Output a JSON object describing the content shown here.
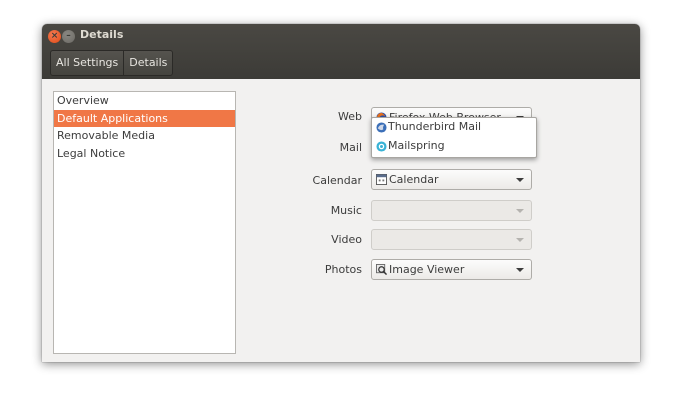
{
  "window": {
    "title": "Details"
  },
  "titlebar": {
    "close_icon": "close-icon",
    "minimize_icon": "minimize-icon"
  },
  "breadcrumbs": [
    "All Settings",
    "Details"
  ],
  "sidebar": {
    "items": [
      {
        "label": "Overview",
        "selected": false
      },
      {
        "label": "Default Applications",
        "selected": true
      },
      {
        "label": "Removable Media",
        "selected": false
      },
      {
        "label": "Legal Notice",
        "selected": false
      }
    ]
  },
  "defaults": {
    "web": {
      "label": "Web",
      "value": "Firefox Web Browser",
      "icon": "firefox-icon",
      "enabled": true
    },
    "mail": {
      "label": "Mail",
      "value": "",
      "enabled": true
    },
    "calendar": {
      "label": "Calendar",
      "value": "Calendar",
      "icon": "calendar-icon",
      "enabled": true
    },
    "music": {
      "label": "Music",
      "value": "",
      "enabled": false
    },
    "video": {
      "label": "Video",
      "value": "",
      "enabled": false
    },
    "photos": {
      "label": "Photos",
      "value": "Image Viewer",
      "icon": "image-viewer-icon",
      "enabled": true
    }
  },
  "mail_dropdown": {
    "options": [
      {
        "label": "Thunderbird Mail",
        "icon": "thunderbird-icon"
      },
      {
        "label": "Mailspring",
        "icon": "mailspring-icon"
      }
    ]
  },
  "colors": {
    "accent": "#f07746",
    "titlebar": "#3c3b37",
    "window_bg": "#f2f1f0"
  }
}
